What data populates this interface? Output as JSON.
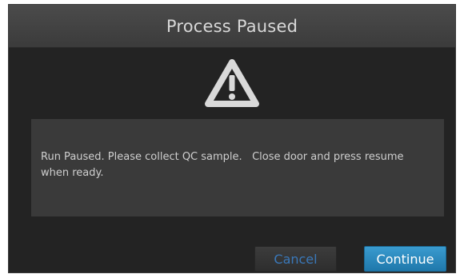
{
  "dialog": {
    "title": "Process Paused",
    "icon": "warning-triangle-icon",
    "message": "Run Paused. Please collect QC sample.   Close door and press resume when ready.",
    "buttons": {
      "cancel_label": "Cancel",
      "continue_label": "Continue"
    }
  },
  "colors": {
    "background": "#232323",
    "titlebar": "#434343",
    "panel": "#3a3a3a",
    "accent": "#2a88bf",
    "cancel_text": "#3a78b9"
  }
}
